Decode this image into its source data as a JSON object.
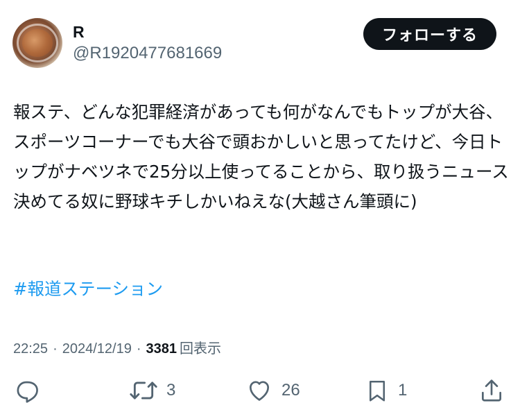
{
  "user": {
    "display_name": "R",
    "handle": "@R1920477681669"
  },
  "follow_button": {
    "label": "フォローする"
  },
  "tweet": {
    "text": "報ステ、どんな犯罪経済があっても何がなんでもトップが大谷、スポーツコーナーでも大谷で頭おかしいと思ってたけど、今日トップがナベツネで25分以上使ってることから、取り扱うニュース決めてる奴に野球キチしかいねえな(大越さん筆頭に)",
    "hashtag": "#報道ステーション"
  },
  "meta": {
    "time": "22:25",
    "separator": "·",
    "date": "2024/12/19",
    "views_count": "3381",
    "views_label": "回表示"
  },
  "actions": {
    "reply": {
      "icon": "reply-icon",
      "count": ""
    },
    "retweet": {
      "icon": "retweet-icon",
      "count": "3"
    },
    "like": {
      "icon": "heart-icon",
      "count": "26"
    },
    "bookmark": {
      "icon": "bookmark-icon",
      "count": "1"
    },
    "share": {
      "icon": "share-icon",
      "count": ""
    }
  },
  "colors": {
    "text": "#0f1419",
    "secondary": "#536471",
    "link": "#1d9bf0",
    "button_bg": "#0f1419"
  }
}
